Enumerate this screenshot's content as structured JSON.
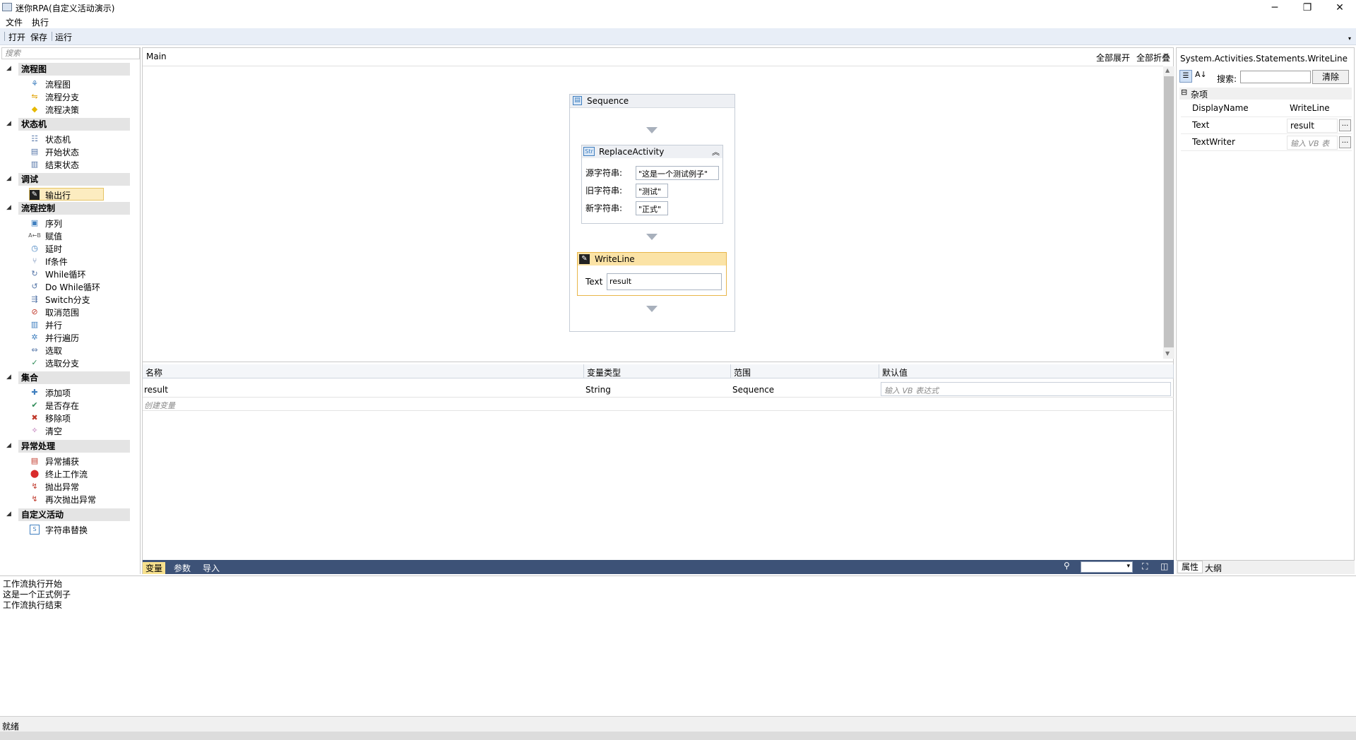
{
  "window": {
    "title": "迷你RPA(自定义活动演示)"
  },
  "menu": {
    "items": [
      "文件",
      "执行"
    ]
  },
  "toolbar": {
    "open": "打开",
    "save": "保存",
    "run": "运行"
  },
  "toolbox": {
    "search_placeholder": "搜索",
    "categories": [
      {
        "label": "流程图",
        "items": [
          {
            "label": "流程图",
            "icon": "flowchart-icon"
          },
          {
            "label": "流程分支",
            "icon": "flow-switch-icon"
          },
          {
            "label": "流程决策",
            "icon": "flow-decision-icon"
          }
        ]
      },
      {
        "label": "状态机",
        "items": [
          {
            "label": "状态机",
            "icon": "state-machine-icon"
          },
          {
            "label": "开始状态",
            "icon": "initial-state-icon"
          },
          {
            "label": "结束状态",
            "icon": "final-state-icon"
          }
        ]
      },
      {
        "label": "调试",
        "items": [
          {
            "label": "输出行",
            "icon": "writeline-icon",
            "selected": true
          }
        ]
      },
      {
        "label": "流程控制",
        "items": [
          {
            "label": "序列",
            "icon": "sequence-icon"
          },
          {
            "label": "赋值",
            "icon": "assign-icon"
          },
          {
            "label": "延时",
            "icon": "delay-icon"
          },
          {
            "label": "If条件",
            "icon": "if-icon"
          },
          {
            "label": "While循环",
            "icon": "while-icon"
          },
          {
            "label": "Do While循环",
            "icon": "do-while-icon"
          },
          {
            "label": "Switch分支",
            "icon": "switch-icon"
          },
          {
            "label": "取消范围",
            "icon": "cancellation-scope-icon"
          },
          {
            "label": "并行",
            "icon": "parallel-icon"
          },
          {
            "label": "并行遍历",
            "icon": "parallel-foreach-icon"
          },
          {
            "label": "选取",
            "icon": "pick-icon"
          },
          {
            "label": "选取分支",
            "icon": "pick-branch-icon"
          }
        ]
      },
      {
        "label": "集合",
        "items": [
          {
            "label": "添加项",
            "icon": "add-to-collection-icon"
          },
          {
            "label": "是否存在",
            "icon": "exists-in-collection-icon"
          },
          {
            "label": "移除项",
            "icon": "remove-from-collection-icon"
          },
          {
            "label": "清空",
            "icon": "clear-collection-icon"
          }
        ]
      },
      {
        "label": "异常处理",
        "items": [
          {
            "label": "异常捕获",
            "icon": "try-catch-icon"
          },
          {
            "label": "终止工作流",
            "icon": "terminate-workflow-icon"
          },
          {
            "label": "抛出异常",
            "icon": "throw-icon"
          },
          {
            "label": "再次抛出异常",
            "icon": "rethrow-icon"
          }
        ]
      },
      {
        "label": "自定义活动",
        "items": [
          {
            "label": "字符串替换",
            "icon": "string-replace-icon"
          }
        ]
      }
    ]
  },
  "designer": {
    "breadcrumb": "Main",
    "expand_all": "全部展开",
    "collapse_all": "全部折叠",
    "sequence": {
      "title": "Sequence"
    },
    "replace": {
      "title": "ReplaceActivity",
      "source_label": "源字符串:",
      "source_value": "\"这是一个测试例子\"",
      "old_label": "旧字符串:",
      "old_value": "\"测试\"",
      "new_label": "新字符串:",
      "new_value": "\"正式\""
    },
    "writeline": {
      "title": "WriteLine",
      "text_label": "Text",
      "text_value": "result"
    }
  },
  "variables": {
    "headers": {
      "name": "名称",
      "type": "变量类型",
      "scope": "范围",
      "default": "默认值"
    },
    "rows": [
      {
        "name": "result",
        "type": "String",
        "scope": "Sequence",
        "default_placeholder": "输入 VB 表达式"
      }
    ],
    "create": "创建变量"
  },
  "designer_tabs": {
    "variables": "变量",
    "arguments": "参数",
    "imports": "导入"
  },
  "properties": {
    "type_name": "System.Activities.Statements.WriteLine",
    "search_label": "搜索:",
    "clear": "清除",
    "category": "杂项",
    "rows": [
      {
        "name": "DisplayName",
        "value": "WriteLine"
      },
      {
        "name": "Text",
        "value": "result"
      },
      {
        "name": "TextWriter",
        "placeholder": "输入 VB 表"
      }
    ],
    "tabs": {
      "properties": "属性",
      "outline": "大纲"
    }
  },
  "output": {
    "lines": [
      "工作流执行开始",
      "这是一个正式例子",
      "工作流执行结束"
    ]
  },
  "status": {
    "text": "就绪"
  }
}
